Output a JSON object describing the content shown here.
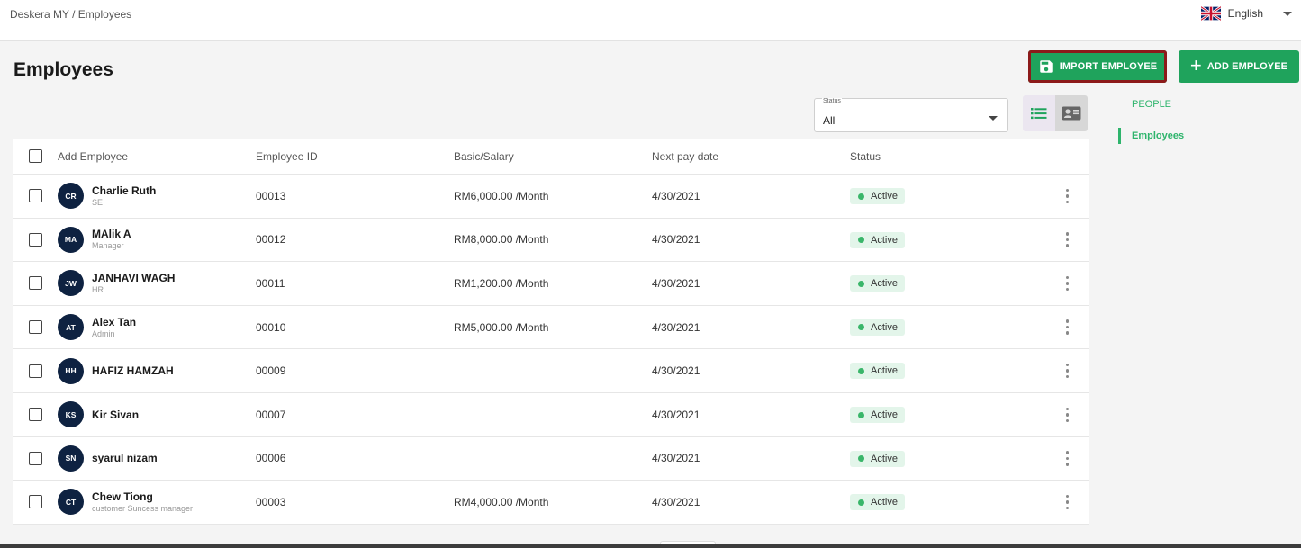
{
  "breadcrumb": "Deskera MY / Employees",
  "language": {
    "label": "English",
    "icon": "uk-flag-icon"
  },
  "page_title": "Employees",
  "buttons": {
    "import_label": "IMPORT EMPLOYEE",
    "add_label": "ADD EMPLOYEE"
  },
  "filter": {
    "label": "Status",
    "value": "All"
  },
  "side_nav": {
    "section": "PEOPLE",
    "item": "Employees"
  },
  "table": {
    "headers": {
      "name": "Add Employee",
      "id": "Employee ID",
      "salary": "Basic/Salary",
      "pay_date": "Next pay date",
      "status": "Status"
    },
    "rows": [
      {
        "initials": "CR",
        "name": "Charlie Ruth",
        "role": "SE",
        "id": "00013",
        "salary": "RM6,000.00 /Month",
        "pay_date": "4/30/2021",
        "status": "Active"
      },
      {
        "initials": "MA",
        "name": "MAlik A",
        "role": "Manager",
        "id": "00012",
        "salary": "RM8,000.00 /Month",
        "pay_date": "4/30/2021",
        "status": "Active"
      },
      {
        "initials": "JW",
        "name": "JANHAVI WAGH",
        "role": "HR",
        "id": "00011",
        "salary": "RM1,200.00 /Month",
        "pay_date": "4/30/2021",
        "status": "Active"
      },
      {
        "initials": "AT",
        "name": "Alex Tan",
        "role": "Admin",
        "id": "00010",
        "salary": "RM5,000.00 /Month",
        "pay_date": "4/30/2021",
        "status": "Active"
      },
      {
        "initials": "HH",
        "name": "HAFIZ HAMZAH",
        "role": "",
        "id": "00009",
        "salary": "",
        "pay_date": "4/30/2021",
        "status": "Active"
      },
      {
        "initials": "KS",
        "name": "Kir Sivan",
        "role": "",
        "id": "00007",
        "salary": "",
        "pay_date": "4/30/2021",
        "status": "Active"
      },
      {
        "initials": "SN",
        "name": "syarul nizam",
        "role": "",
        "id": "00006",
        "salary": "",
        "pay_date": "4/30/2021",
        "status": "Active"
      },
      {
        "initials": "CT",
        "name": "Chew Tiong",
        "role": "customer Suncess manager",
        "id": "00003",
        "salary": "RM4,000.00 /Month",
        "pay_date": "4/30/2021",
        "status": "Active"
      }
    ]
  },
  "colors": {
    "accent_green": "#1fa35c",
    "avatar_navy": "#0e2241",
    "active_badge_bg": "#e3f5ea",
    "highlight_border": "#8c1a1a"
  }
}
